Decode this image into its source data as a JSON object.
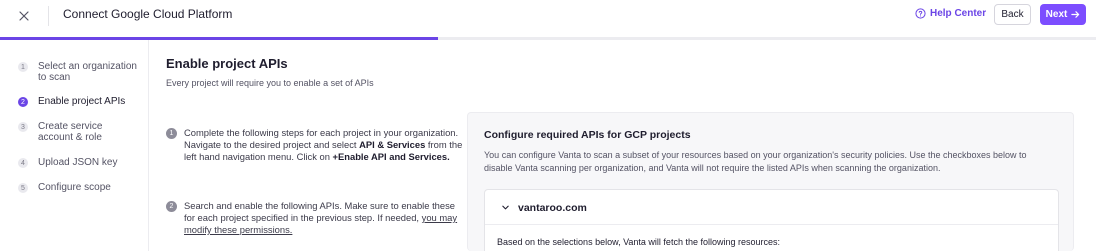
{
  "header": {
    "title": "Connect Google Cloud Platform",
    "help_label": "Help Center",
    "back_label": "Back",
    "next_label": "Next"
  },
  "progress": {
    "value_fraction": 0.4,
    "accent": "#6b45e6"
  },
  "steps": [
    {
      "num": "1",
      "label": "Select an organization to scan",
      "active": false
    },
    {
      "num": "2",
      "label": "Enable project APIs",
      "active": true
    },
    {
      "num": "3",
      "label": "Create service account & role",
      "active": false
    },
    {
      "num": "4",
      "label": "Upload JSON key",
      "active": false
    },
    {
      "num": "5",
      "label": "Configure scope",
      "active": false
    }
  ],
  "main": {
    "title": "Enable project APIs",
    "subtitle": "Every project will require you to enable a set of APIs",
    "instructions": [
      {
        "num": "1",
        "t1": "Complete the following steps for each project in your organization. Navigate to the desired project and select ",
        "b1": "API & Services",
        "t2": " from the left hand navigation menu. Click on ",
        "b2": "+Enable API and Services."
      },
      {
        "num": "2",
        "t1": "Search and enable the following APIs. Make sure to enable these for each project specified in the previous step. If needed, ",
        "link": "you may modify these permissions."
      }
    ]
  },
  "panel": {
    "title": "Configure required APIs for GCP projects",
    "description": "You can configure Vanta to scan a subset of your resources based on your organization's security policies. Use the checkboxes below to disable Vanta scanning per organization, and Vanta will not require the listed APIs when scanning the organization.",
    "org": {
      "name": "vantaroo.com",
      "body": "Based on the selections below, Vanta will fetch the following resources:"
    }
  },
  "icons": {
    "close": "close-icon",
    "help": "help-circle-icon",
    "next_arrow": "arrow-right-icon",
    "chevron": "chevron-down-icon"
  }
}
